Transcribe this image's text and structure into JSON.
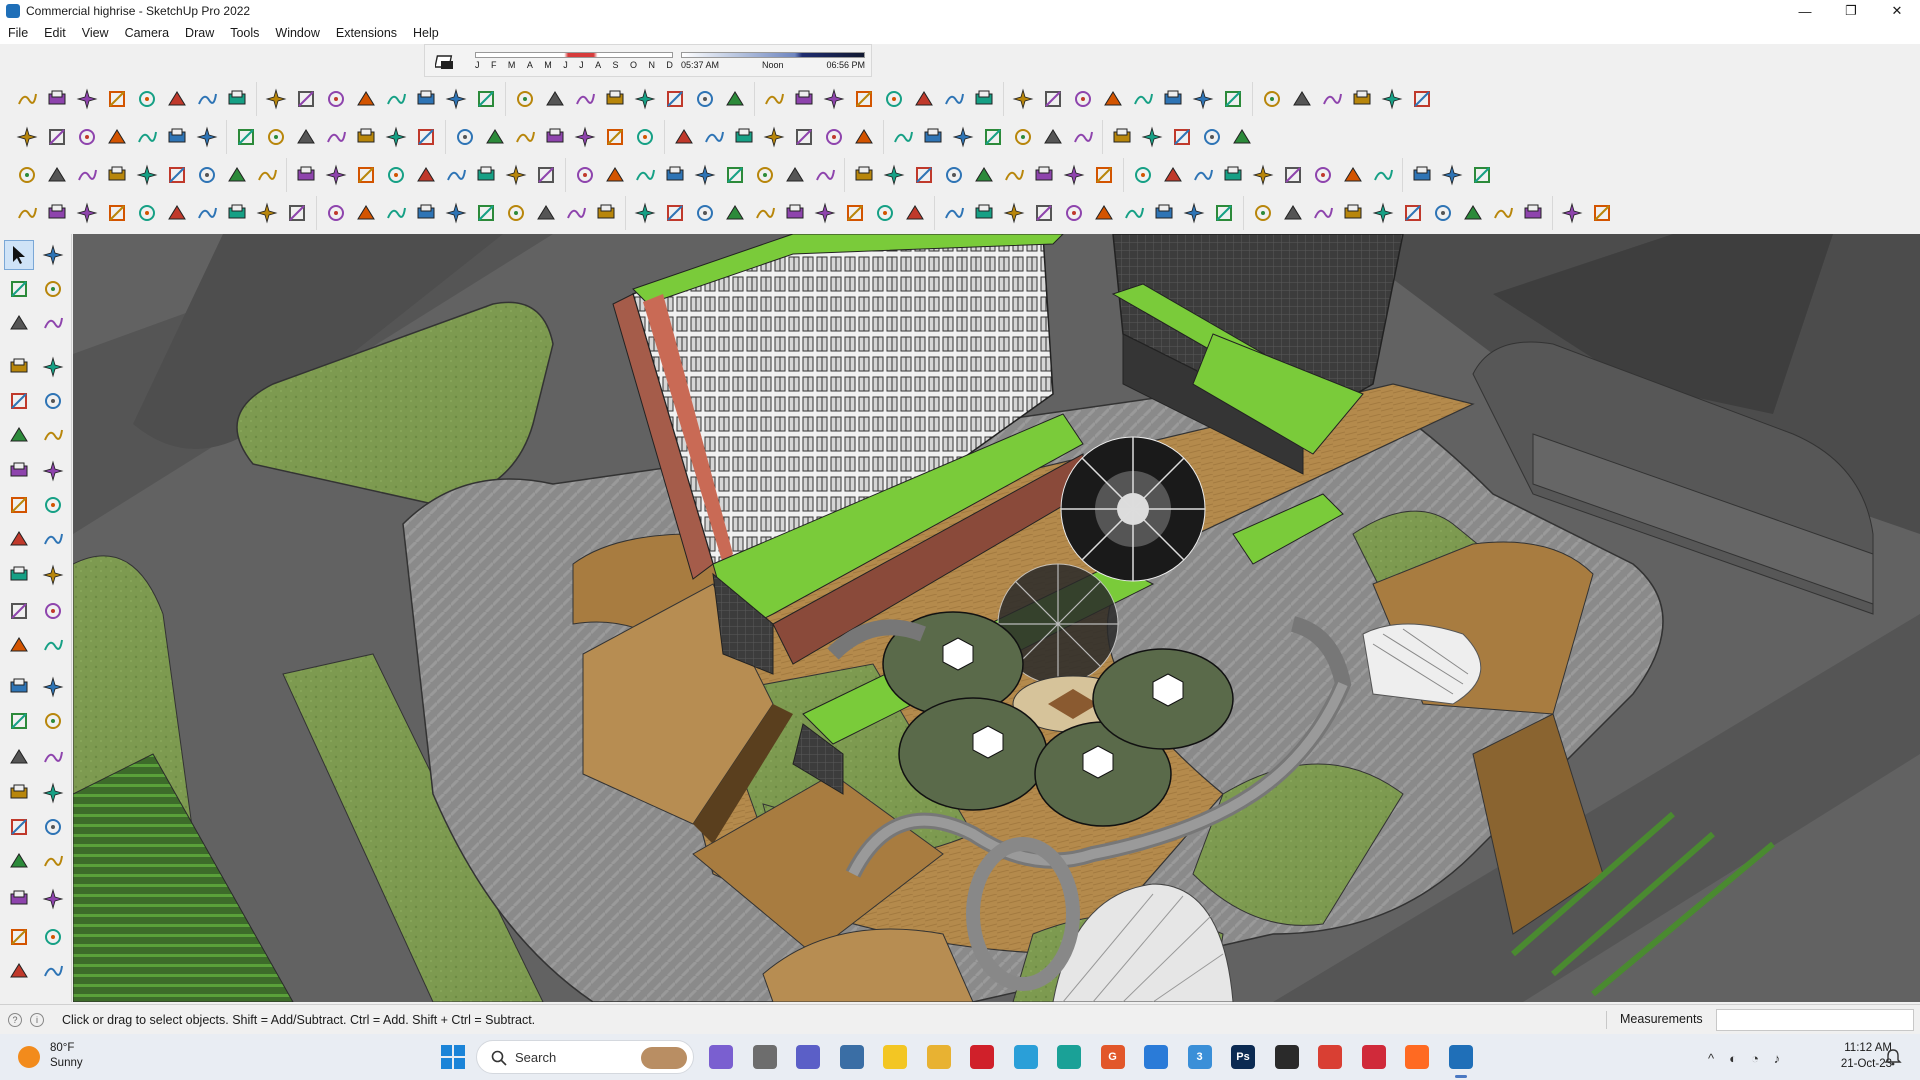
{
  "window": {
    "title": "Commercial highrise - SketchUp Pro 2022",
    "controls": [
      "—",
      "❐",
      "✕"
    ]
  },
  "menu": [
    "File",
    "Edit",
    "View",
    "Camera",
    "Draw",
    "Tools",
    "Window",
    "Extensions",
    "Help"
  ],
  "shadows": {
    "months": [
      "J",
      "F",
      "M",
      "A",
      "M",
      "J",
      "J",
      "A",
      "S",
      "O",
      "N",
      "D"
    ],
    "time_start": "05:37 AM",
    "time_mid": "Noon",
    "time_end": "06:56 PM",
    "month_marker": 0.44,
    "time_marker": 0.64
  },
  "toolbars": {
    "row1_count": 46,
    "row2_count": 40,
    "row3_count": 48,
    "row4_count": 52
  },
  "status": {
    "hint": "Click or drag to select objects. Shift = Add/Subtract. Ctrl = Add. Shift + Ctrl = Subtract.",
    "measurements_label": "Measurements",
    "measurements_value": ""
  },
  "taskbar": {
    "weather_temp": "80°F",
    "weather_condition": "Sunny",
    "search_placeholder": "Search",
    "apps": [
      {
        "name": "copilot",
        "color": "#7a5fd0",
        "label": ""
      },
      {
        "name": "task-view",
        "color": "#6d6d6d",
        "label": ""
      },
      {
        "name": "teams",
        "color": "#5b5fc7",
        "label": ""
      },
      {
        "name": "calculator",
        "color": "#3a6ea5",
        "label": ""
      },
      {
        "name": "sticky-notes",
        "color": "#f3c623",
        "label": ""
      },
      {
        "name": "file-explorer",
        "color": "#e8b232",
        "label": ""
      },
      {
        "name": "opera",
        "color": "#d0202a",
        "label": ""
      },
      {
        "name": "telegram",
        "color": "#2a9fd8",
        "label": ""
      },
      {
        "name": "vector-app",
        "color": "#1aa197",
        "label": ""
      },
      {
        "name": "g-app",
        "color": "#e2572a",
        "label": "G"
      },
      {
        "name": "mail-check",
        "color": "#2a7bd8",
        "label": ""
      },
      {
        "name": "zoom-app",
        "color": "#3a8fd8",
        "label": "3"
      },
      {
        "name": "photoshop",
        "color": "#0b2a52",
        "label": "Ps"
      },
      {
        "name": "autodesk",
        "color": "#2a2a2a",
        "label": ""
      },
      {
        "name": "chrome",
        "color": "#d93f33",
        "label": ""
      },
      {
        "name": "pinterest",
        "color": "#d02a3a",
        "label": ""
      },
      {
        "name": "soundcloud",
        "color": "#ff6a22",
        "label": ""
      },
      {
        "name": "sketchup",
        "color": "#1f6fb8",
        "label": ""
      }
    ],
    "tray": [
      "^",
      "◐",
      "◔",
      "♪"
    ],
    "time": "11:12 AM",
    "date": "21-Oct-23"
  }
}
